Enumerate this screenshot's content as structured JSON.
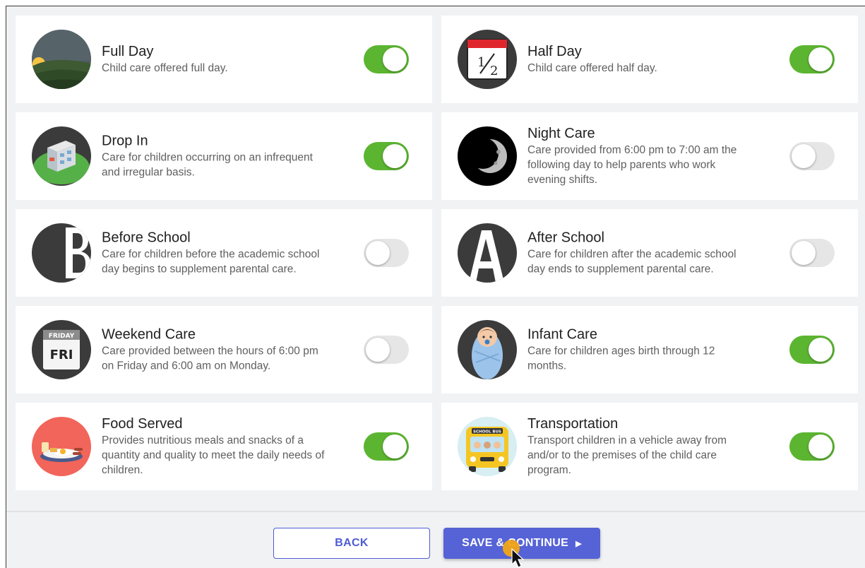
{
  "services": [
    {
      "title": "Full Day",
      "desc": "Child care offered full day.",
      "enabled": true,
      "icon": "landscape-sunset-icon"
    },
    {
      "title": "Half Day",
      "desc": "Child care offered half day.",
      "enabled": true,
      "icon": "calendar-half-icon"
    },
    {
      "title": "Drop In",
      "desc": "Care for children occurring on an infrequent and irregular basis.",
      "enabled": true,
      "icon": "building-icon"
    },
    {
      "title": "Night Care",
      "desc": "Care provided from 6:00 pm to 7:00 am the following day to help parents who work evening shifts.",
      "enabled": false,
      "icon": "moon-icon"
    },
    {
      "title": "Before School",
      "desc": "Care for children before the academic school day begins to supplement parental care.",
      "enabled": false,
      "icon": "letter-b-icon"
    },
    {
      "title": "After School",
      "desc": "Care for children after the academic school day ends to supplement parental care.",
      "enabled": false,
      "icon": "letter-a-icon"
    },
    {
      "title": "Weekend Care",
      "desc": "Care provided between the hours of 6:00 pm on Friday and 6:00 am on Monday.",
      "enabled": false,
      "icon": "calendar-friday-icon",
      "icon_text": {
        "top": "FRIDAY",
        "main": "FRI"
      }
    },
    {
      "title": "Infant Care",
      "desc": "Care for children ages birth through 12 months.",
      "enabled": true,
      "icon": "swaddled-baby-icon"
    },
    {
      "title": "Food Served",
      "desc": "Provides nutritious meals and snacks of a quantity and quality to meet the daily needs of children.",
      "enabled": true,
      "icon": "breakfast-plate-icon"
    },
    {
      "title": "Transportation",
      "desc": "Transport children in a vehicle away from and/or to the premises of the child care program.",
      "enabled": true,
      "icon": "school-bus-icon",
      "icon_text": {
        "sign": "SCHOOL BUS"
      }
    }
  ],
  "footer": {
    "back_label": "BACK",
    "save_label": "SAVE & CONTINUE",
    "save_arrow": "▶"
  },
  "colors": {
    "toggle_on": "#5cb531",
    "toggle_off": "#e6e6e6",
    "accent": "#5563d6"
  }
}
